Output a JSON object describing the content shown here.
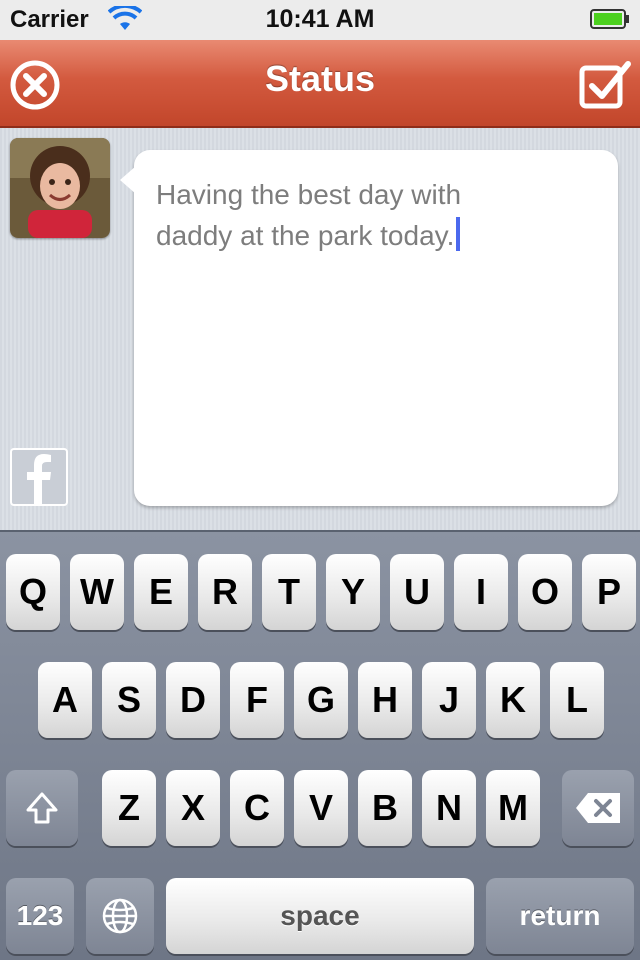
{
  "status_bar": {
    "carrier": "Carrier",
    "time": "10:41 AM",
    "wifi_icon": "wifi-icon",
    "battery_icon": "battery-icon",
    "battery_color": "#4cd01f"
  },
  "nav": {
    "title": "Status",
    "left_icon": "close-icon",
    "right_icon": "checkbox-icon",
    "accent": "#c9492d"
  },
  "compose": {
    "text": "Having the best day with\ndaddy at the park today.",
    "caret_color": "#4b69ee",
    "avatar_icon": "avatar",
    "share_icon": "facebook-icon"
  },
  "keyboard": {
    "row1": [
      "Q",
      "W",
      "E",
      "R",
      "T",
      "Y",
      "U",
      "I",
      "O",
      "P"
    ],
    "row2": [
      "A",
      "S",
      "D",
      "F",
      "G",
      "H",
      "J",
      "K",
      "L"
    ],
    "row3": [
      "Z",
      "X",
      "C",
      "V",
      "B",
      "N",
      "M"
    ],
    "shift_icon": "shift-icon",
    "delete_icon": "backspace-icon",
    "numbers_label": "123",
    "globe_icon": "globe-icon",
    "space_label": "space",
    "return_label": "return"
  }
}
